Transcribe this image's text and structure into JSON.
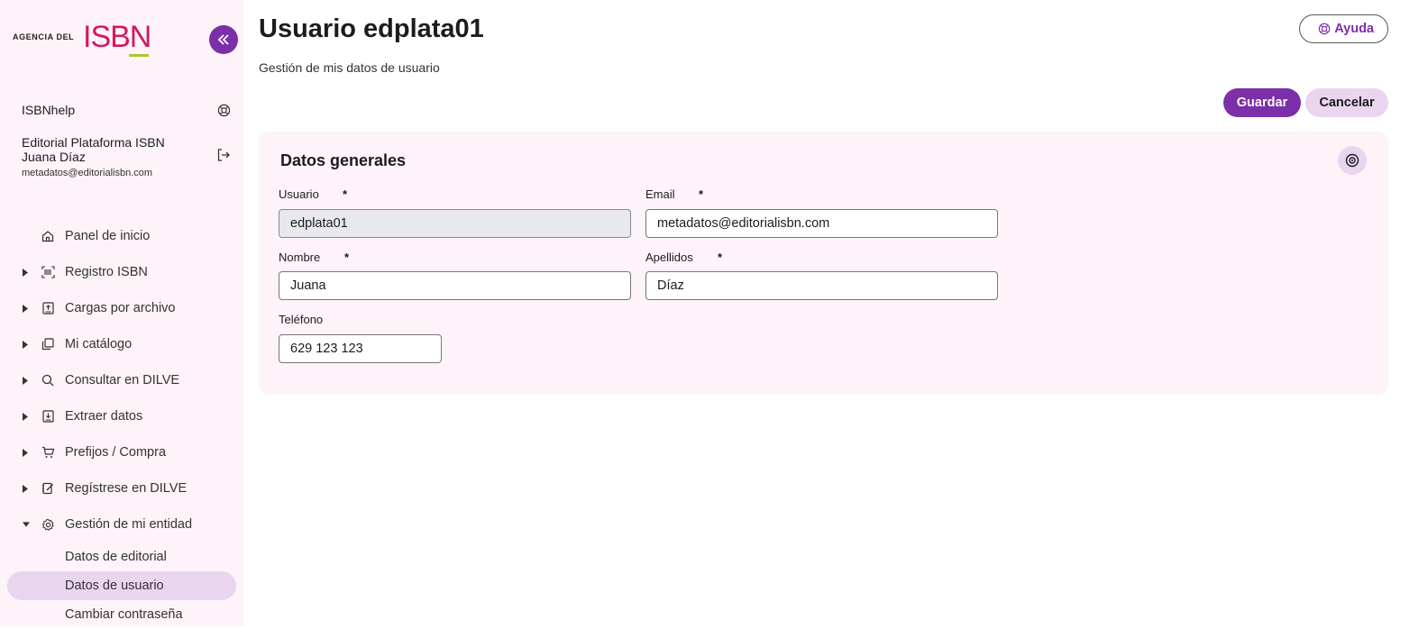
{
  "sidebar": {
    "logo_small": "AGENCIA DEL",
    "logo_big": "ISBN",
    "help_label": "ISBNhelp",
    "entity": "Editorial Plataforma ISBN",
    "user_name": "Juana Díaz",
    "user_email": "metadatos@editorialisbn.com",
    "nav": [
      {
        "label": "Panel de inicio",
        "icon": "home-icon"
      },
      {
        "label": "Registro ISBN",
        "icon": "barcode-icon"
      },
      {
        "label": "Cargas por archivo",
        "icon": "upload-file-icon"
      },
      {
        "label": "Mi catálogo",
        "icon": "catalog-icon"
      },
      {
        "label": "Consultar en DILVE",
        "icon": "search-icon"
      },
      {
        "label": "Extraer datos",
        "icon": "download-file-icon"
      },
      {
        "label": "Prefijos / Compra",
        "icon": "cart-icon"
      },
      {
        "label": "Regístrese en DILVE",
        "icon": "register-icon"
      },
      {
        "label": "Gestión de mi entidad",
        "icon": "gear-icon"
      }
    ],
    "subnav": [
      {
        "label": "Datos de editorial"
      },
      {
        "label": "Datos de usuario"
      },
      {
        "label": "Cambiar contraseña"
      }
    ]
  },
  "main": {
    "title": "Usuario edplata01",
    "subtitle": "Gestión de mis datos de usuario",
    "help_button": "Ayuda",
    "save_button": "Guardar",
    "cancel_button": "Cancelar",
    "card_title": "Datos generales",
    "fields": {
      "usuario": {
        "label": "Usuario",
        "value": "edplata01"
      },
      "email": {
        "label": "Email",
        "value": "metadatos@editorialisbn.com"
      },
      "nombre": {
        "label": "Nombre",
        "value": "Juana"
      },
      "apellidos": {
        "label": "Apellidos",
        "value": "Díaz"
      },
      "telefono": {
        "label": "Teléfono",
        "value": "629 123 123"
      }
    },
    "required_mark": "*"
  },
  "colors": {
    "accent": "#7b2fa8",
    "brand_red": "#d6175d",
    "brand_green": "#a5c92b",
    "sidebar_bg": "#fdf3f8",
    "highlight": "#ead5ef"
  }
}
